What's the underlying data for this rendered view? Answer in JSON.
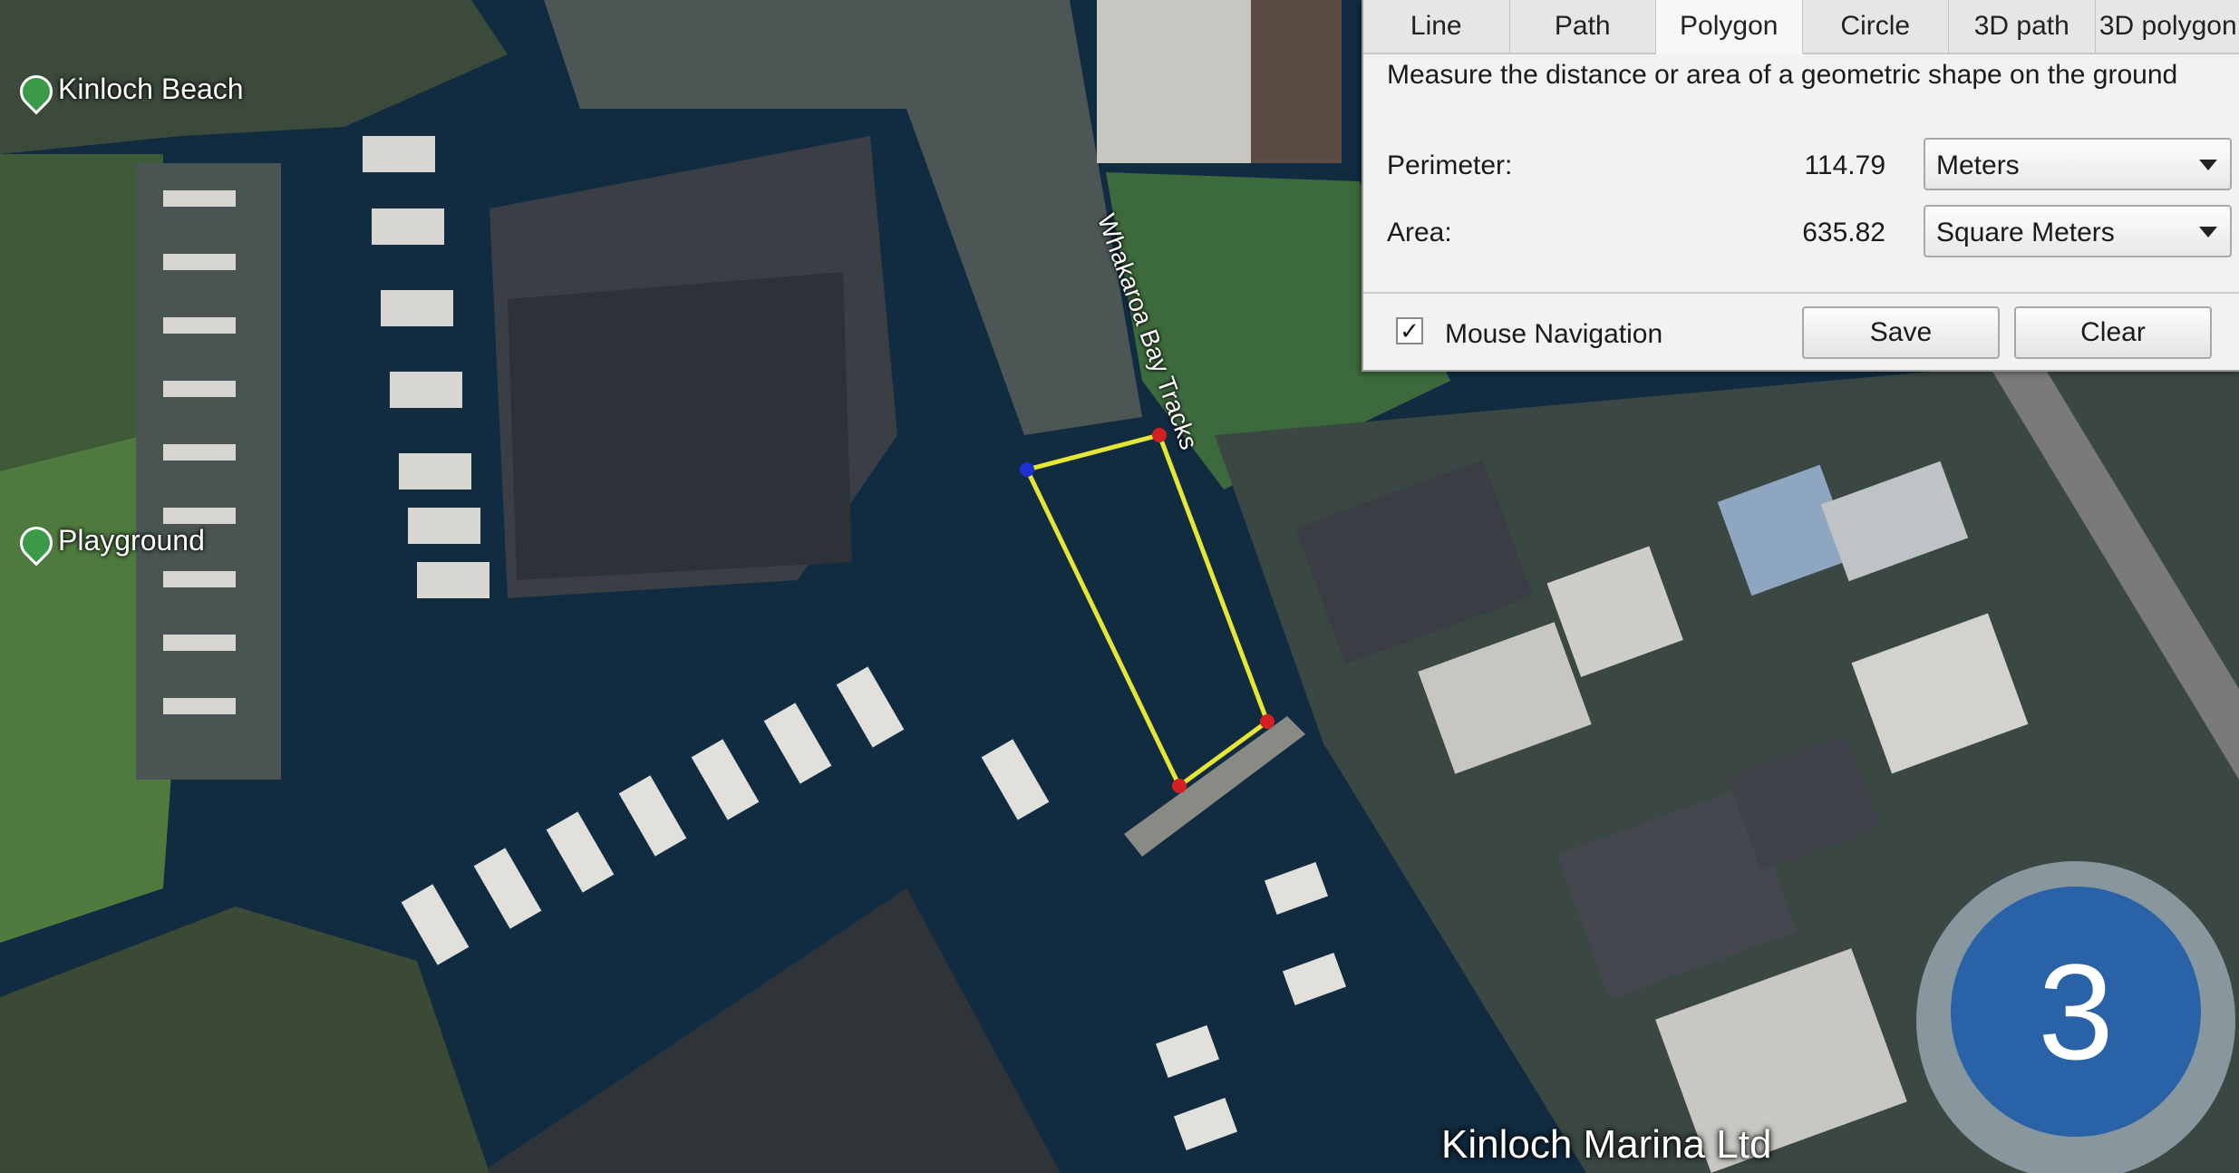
{
  "map": {
    "labels": {
      "kinloch_beach": "Kinloch Beach",
      "playground": "Playground",
      "road": "Whakaroa Bay Tracks",
      "marina": "Kinloch Marina Ltd"
    },
    "colors": {
      "water": "#0f2a40",
      "polygon_line": "#e6e635",
      "vertex": "#d42020",
      "start_vertex": "#2030d0"
    }
  },
  "panel": {
    "tabs": [
      "Line",
      "Path",
      "Polygon",
      "Circle",
      "3D path",
      "3D polygon"
    ],
    "active_tab": "Polygon",
    "description": "Measure the distance or area of a geometric shape on the ground",
    "perimeter": {
      "label": "Perimeter:",
      "value": "114.79",
      "unit": "Meters"
    },
    "area": {
      "label": "Area:",
      "value": "635.82",
      "unit": "Square Meters"
    },
    "mouse_navigation": {
      "label": "Mouse Navigation",
      "checked": true
    },
    "save_label": "Save",
    "clear_label": "Clear"
  },
  "badge": {
    "number": "3",
    "color": "#2a62a8"
  }
}
